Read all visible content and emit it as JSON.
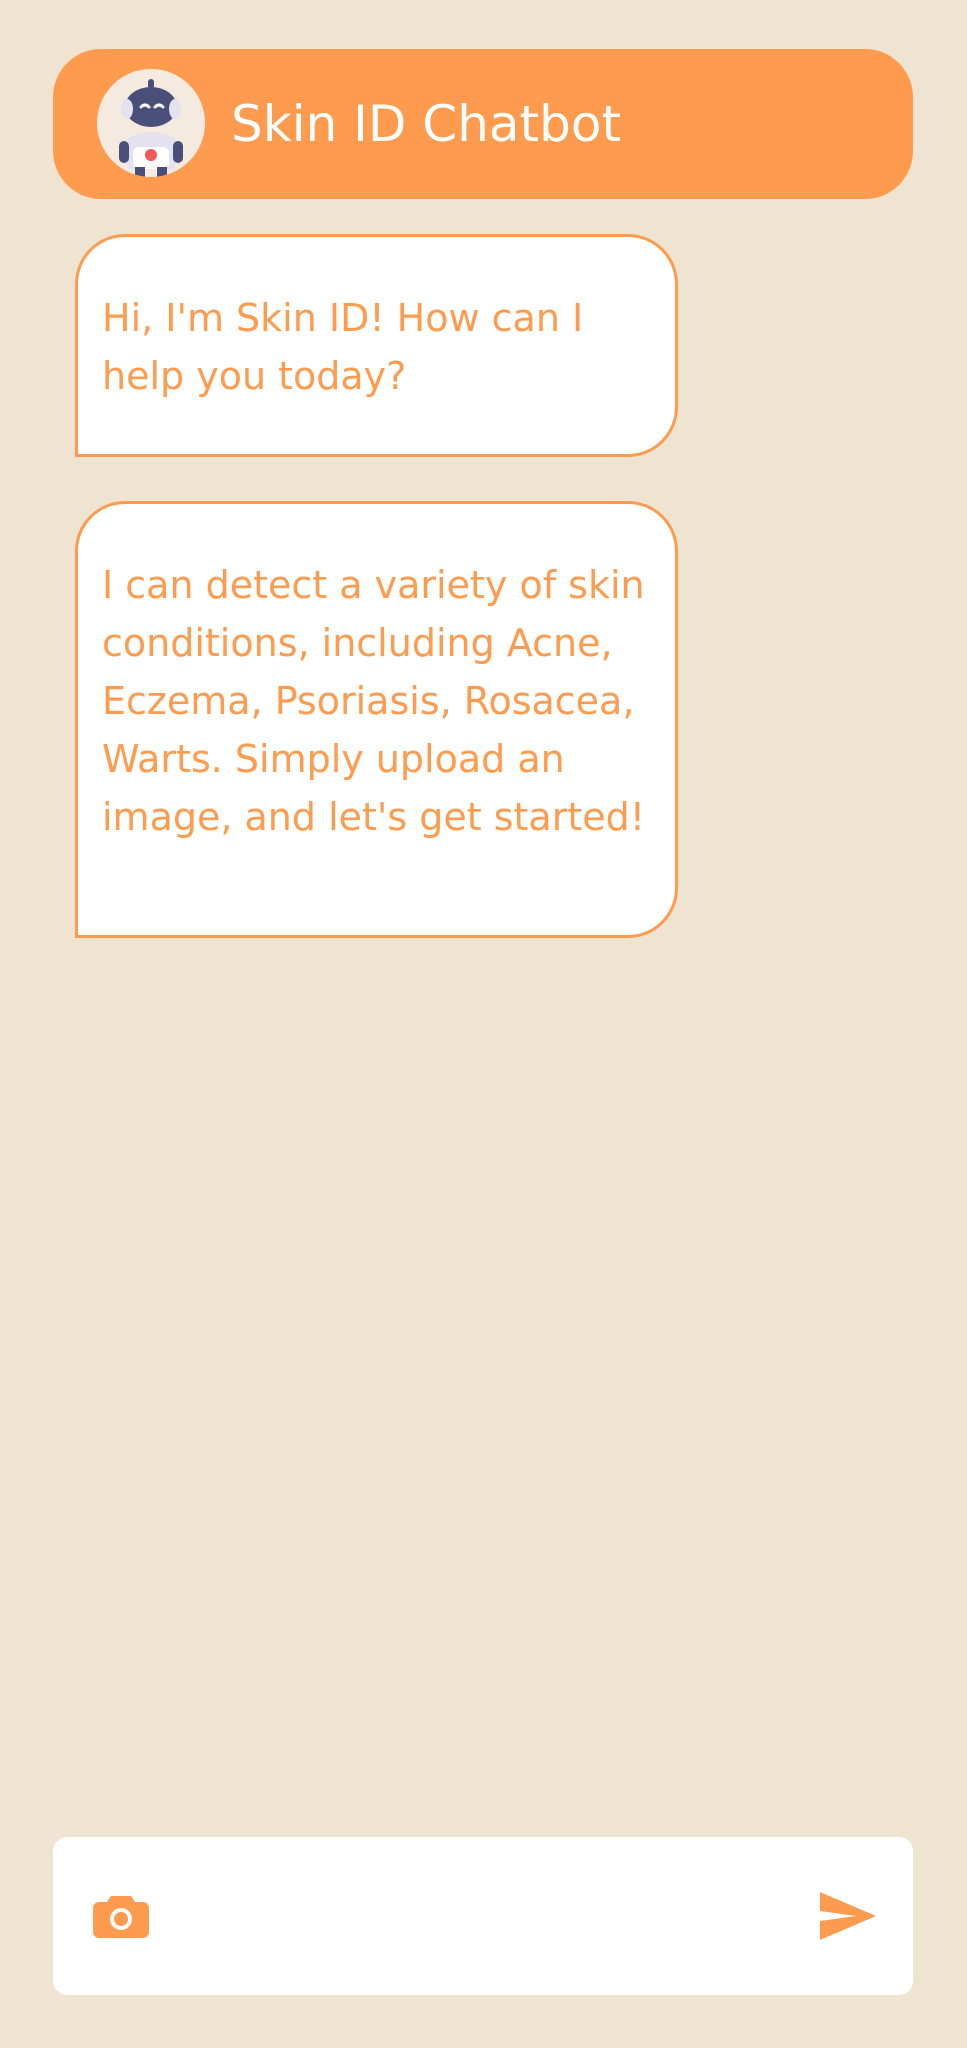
{
  "header": {
    "title": "Skin ID Chatbot",
    "avatar_icon": "robot-avatar-icon"
  },
  "messages": [
    {
      "sender": "bot",
      "text": "Hi, I'm Skin ID! How can I help you today?"
    },
    {
      "sender": "bot",
      "text": "I can detect a variety of skin conditions, including Acne, Eczema, Psoriasis, Rosacea, Warts. Simply upload an image, and let's get started!"
    }
  ],
  "composer": {
    "value": "",
    "placeholder": "",
    "camera_icon": "camera-icon",
    "send_icon": "send-icon"
  },
  "colors": {
    "accent": "#FF9B4E",
    "background": "#EFE3D1",
    "bubble_background": "#FFFFFF",
    "avatar_background": "#F4EAE0",
    "robot_body": "#4A4F7A"
  }
}
